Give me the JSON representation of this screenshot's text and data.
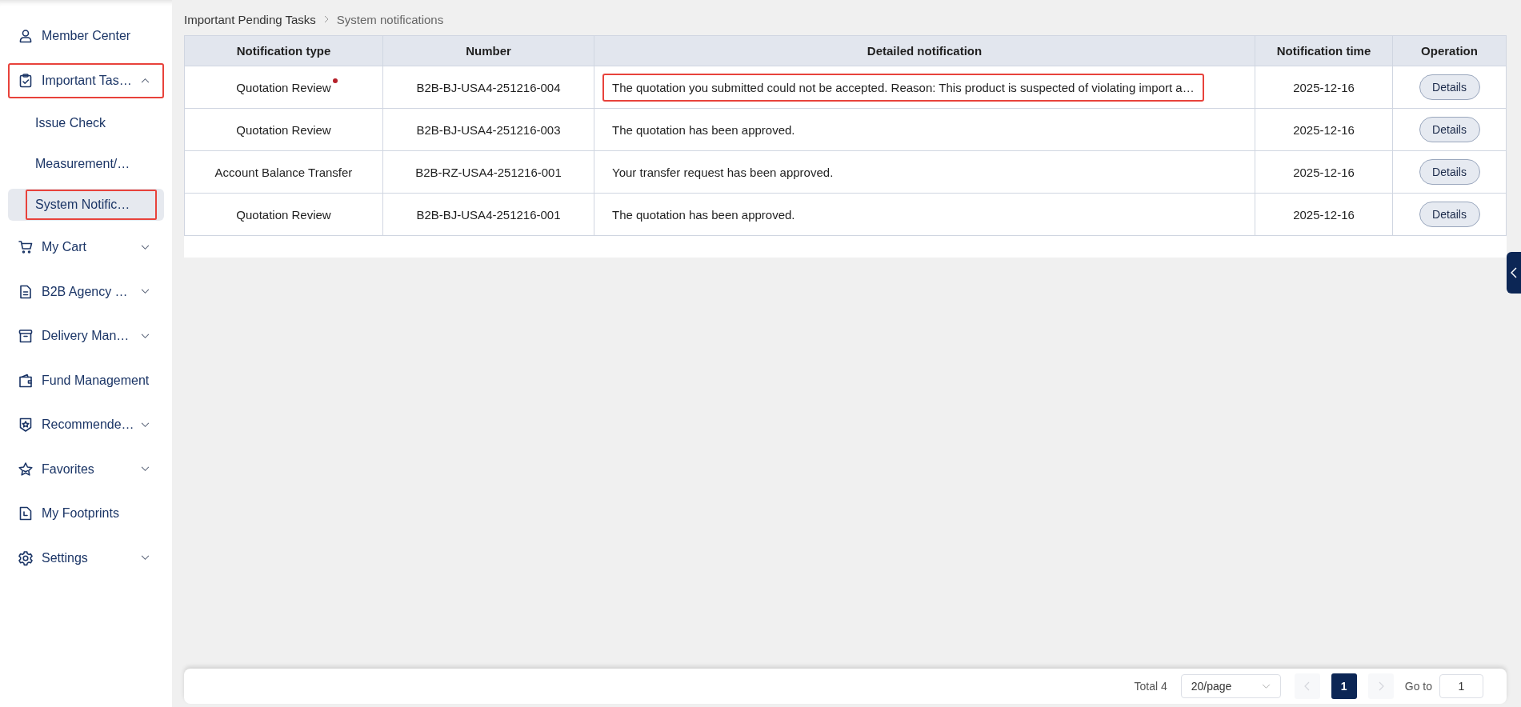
{
  "sidebar": {
    "items": [
      {
        "kind": "link",
        "label": "Member Center",
        "highlighted": false
      },
      {
        "kind": "group",
        "label": "Important Tas…",
        "expanded": true,
        "highlighted": true,
        "children": [
          {
            "label": "Issue Check",
            "selected": false,
            "highlighted": false
          },
          {
            "label": "Measurement/…",
            "selected": false,
            "highlighted": false
          },
          {
            "label": "System Notific…",
            "selected": true,
            "highlighted": true
          }
        ]
      },
      {
        "kind": "group",
        "label": "My Cart",
        "expanded": false,
        "highlighted": false
      },
      {
        "kind": "group",
        "label": "B2B Agency …",
        "expanded": false,
        "highlighted": false
      },
      {
        "kind": "group",
        "label": "Delivery Man…",
        "expanded": false,
        "highlighted": false
      },
      {
        "kind": "link",
        "label": "Fund Management",
        "highlighted": false
      },
      {
        "kind": "group",
        "label": "Recommende…",
        "expanded": false,
        "highlighted": false
      },
      {
        "kind": "group",
        "label": "Favorites",
        "expanded": false,
        "highlighted": false
      },
      {
        "kind": "link",
        "label": "My Footprints",
        "highlighted": false
      },
      {
        "kind": "group",
        "label": "Settings",
        "expanded": false,
        "highlighted": false
      }
    ]
  },
  "breadcrumb": [
    "Important Pending Tasks",
    "System notifications"
  ],
  "table": {
    "columns": [
      "Notification type",
      "Number",
      "Detailed notification",
      "Notification time",
      "Operation"
    ],
    "rows": [
      {
        "type": "Quotation Review",
        "unread": true,
        "number": "B2B-BJ-USA4-251216-004",
        "detail": "The quotation you submitted could not be accepted. Reason: This product is suspected of violating import a…",
        "highlighted": true,
        "time": "2025-12-16",
        "action": "Details"
      },
      {
        "type": "Quotation Review",
        "unread": false,
        "number": "B2B-BJ-USA4-251216-003",
        "detail": "The quotation has been approved.",
        "highlighted": false,
        "time": "2025-12-16",
        "action": "Details"
      },
      {
        "type": "Account Balance Transfer",
        "unread": false,
        "number": "B2B-RZ-USA4-251216-001",
        "detail": "Your transfer request has been approved.",
        "highlighted": false,
        "time": "2025-12-16",
        "action": "Details"
      },
      {
        "type": "Quotation Review",
        "unread": false,
        "number": "B2B-BJ-USA4-251216-001",
        "detail": "The quotation has been approved.",
        "highlighted": false,
        "time": "2025-12-16",
        "action": "Details"
      }
    ]
  },
  "pagination": {
    "total": "Total 4",
    "page_size": "20/page",
    "prev_disabled": true,
    "next_disabled": true,
    "pages": [
      {
        "label": "1",
        "selected": true
      }
    ],
    "goto_label": "Go to",
    "goto_value": "1"
  }
}
